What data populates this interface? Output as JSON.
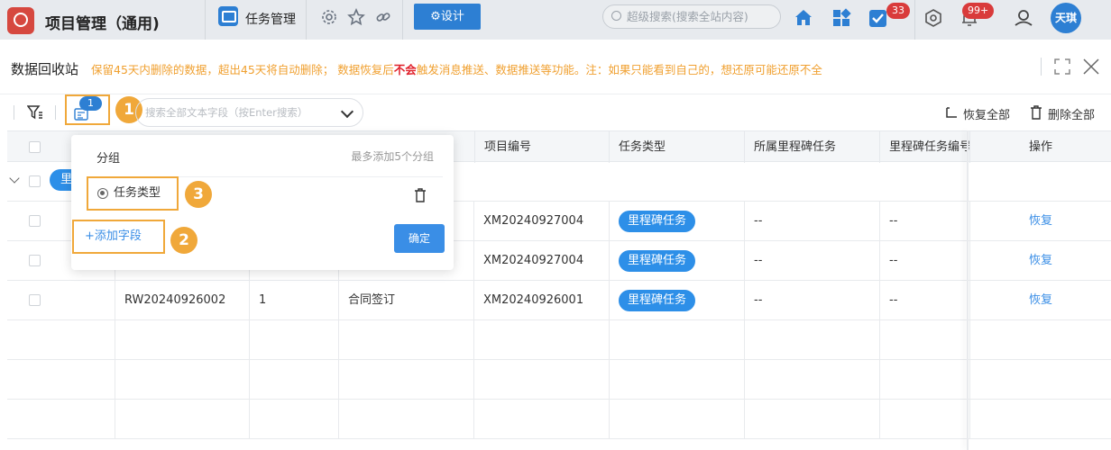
{
  "app": {
    "title": "项目管理（通用)"
  },
  "top_tab": {
    "label": "任务管理"
  },
  "topbar": {
    "design_label": "⚙设计",
    "search_placeholder": "超级搜索(搜索全站内容)",
    "todo_count": "33",
    "notice_count": "99+",
    "avatar_text": "天琪",
    "icons": [
      "settings-icon",
      "star-icon",
      "link-icon",
      "home-icon",
      "apps-icon",
      "todo-icon",
      "cube-icon",
      "bell-icon",
      "user-icon"
    ]
  },
  "page": {
    "title": "数据回收站",
    "notice_prefix": "保留45天内删除的数据，超出45天将自动删除；  数据恢复后",
    "notice_strong": "不会",
    "notice_suffix": "触发消息推送、数据推送等功能。注：如果只能看到自己的，想还原可能还原不全"
  },
  "toolbar": {
    "group_count": "1",
    "search_placeholder": "搜索全部文本字段（按Enter搜索）",
    "restore_all": "恢复全部",
    "delete_all": "删除全部"
  },
  "markers": [
    "1",
    "2",
    "3"
  ],
  "table": {
    "columns": [
      "项目编号",
      "任务类型",
      "所属里程碑任务",
      "里程碑任务编号",
      "操作"
    ],
    "group_tag": "里",
    "rows": [
      {
        "task_no": "",
        "seq": "",
        "name": "",
        "project_no": "XM20240927004",
        "type": "里程碑任务",
        "milestone": "--",
        "milestone_no": "--",
        "action": "恢复"
      },
      {
        "task_no": "",
        "seq": "",
        "name": "",
        "project_no": "XM20240927004",
        "type": "里程碑任务",
        "milestone": "--",
        "milestone_no": "--",
        "action": "恢复"
      },
      {
        "task_no": "RW20240926002",
        "seq": "1",
        "name": "合同签订",
        "project_no": "XM20240926001",
        "type": "里程碑任务",
        "milestone": "--",
        "milestone_no": "--",
        "action": "恢复"
      }
    ]
  },
  "popover": {
    "title": "分组",
    "hint": "最多添加5个分组",
    "group_item": "任务类型",
    "add_field": "+添加字段",
    "confirm": "确定"
  },
  "colors": {
    "primary": "#2d7fd3",
    "accent": "#f0a83a",
    "warning_text": "#f0a030",
    "danger": "#e0202a"
  }
}
